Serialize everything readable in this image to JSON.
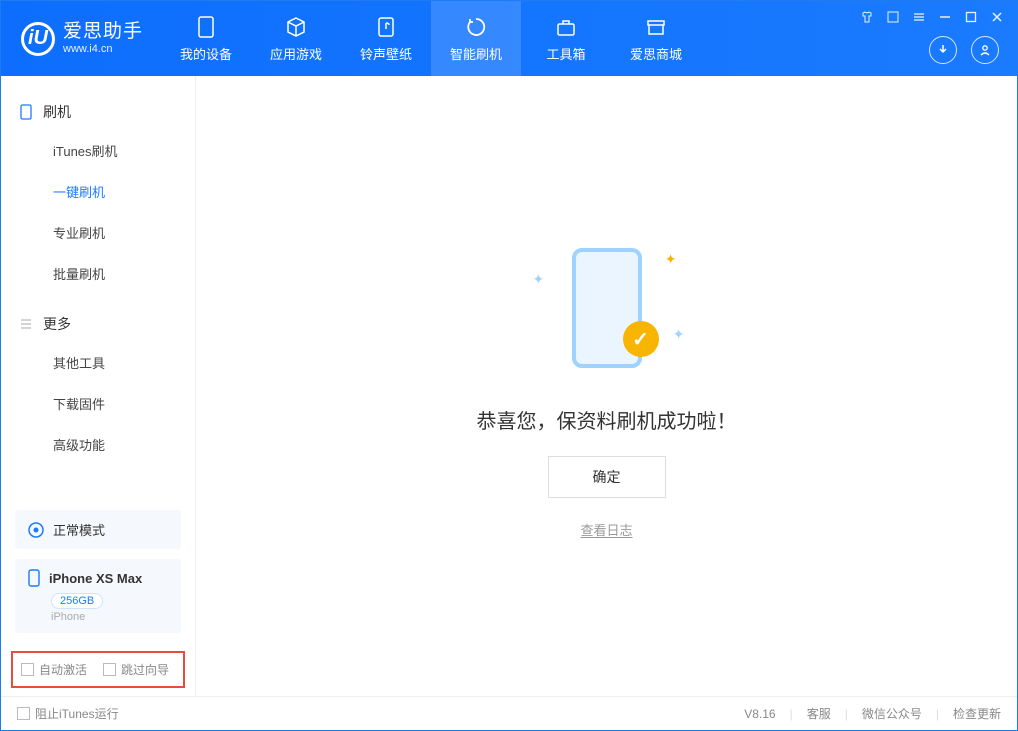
{
  "brand": {
    "name": "爱思助手",
    "url": "www.i4.cn"
  },
  "nav": {
    "device": "我的设备",
    "apps": "应用游戏",
    "ring": "铃声壁纸",
    "flash": "智能刷机",
    "tools": "工具箱",
    "store": "爱思商城"
  },
  "sidebar": {
    "section_flash": "刷机",
    "items_flash": {
      "itunes": "iTunes刷机",
      "onekey": "一键刷机",
      "pro": "专业刷机",
      "batch": "批量刷机"
    },
    "section_more": "更多",
    "items_more": {
      "other": "其他工具",
      "firmware": "下载固件",
      "advanced": "高级功能"
    }
  },
  "mode": {
    "label": "正常模式"
  },
  "device": {
    "name": "iPhone XS Max",
    "capacity": "256GB",
    "type": "iPhone"
  },
  "options": {
    "auto_activate": "自动激活",
    "skip_guide": "跳过向导"
  },
  "main": {
    "success": "恭喜您，保资料刷机成功啦！",
    "ok": "确定",
    "view_log": "查看日志"
  },
  "footer": {
    "block_itunes": "阻止iTunes运行",
    "version": "V8.16",
    "support": "客服",
    "wechat": "微信公众号",
    "update": "检查更新"
  }
}
